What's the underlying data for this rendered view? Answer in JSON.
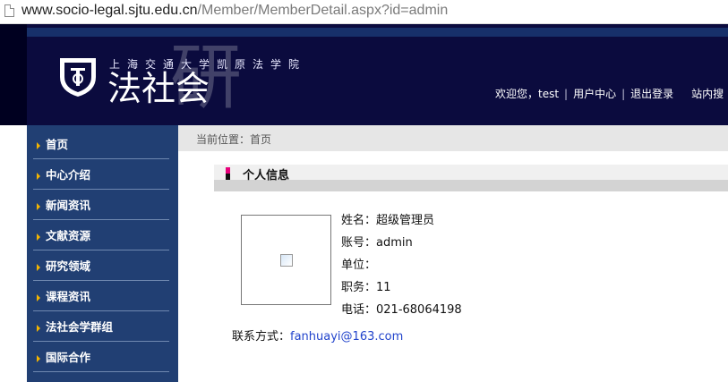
{
  "address_bar": {
    "host": "www.socio-legal.sjtu.edu.cn",
    "path": "/Member/MemberDetail.aspx?id=admin"
  },
  "header": {
    "university": "上海交通大学凯原法学院",
    "brand": "法社会",
    "brand_ghost": "研",
    "user_nav": {
      "greeting": "欢迎您，test",
      "user_center": "用户中心",
      "logout": "退出登录",
      "site_search": "站内搜"
    }
  },
  "sidebar": {
    "items": [
      {
        "label": "首页"
      },
      {
        "label": "中心介绍"
      },
      {
        "label": "新闻资讯"
      },
      {
        "label": "文献资源"
      },
      {
        "label": "研究领域"
      },
      {
        "label": "课程资讯"
      },
      {
        "label": "法社会学群组"
      },
      {
        "label": "国际合作"
      }
    ]
  },
  "breadcrumb": {
    "text": "当前位置：首页"
  },
  "section": {
    "title": "个人信息"
  },
  "profile": {
    "name_label": "姓名：",
    "name": "超级管理员",
    "account_label": "账号：",
    "account": "admin",
    "unit_label": "单位：",
    "unit": "",
    "position_label": "职务：",
    "position": "11",
    "phone_label": "电话：",
    "phone": "021-68064198",
    "contact_label": "联系方式：",
    "contact_email": "fanhuayi@163.com"
  },
  "colors": {
    "header_bg": "#0b0b3e",
    "sidebar_bg": "#213f73",
    "nav_arrow": "#f4b400",
    "section_marker": "#e7007a",
    "link": "#2244cc"
  }
}
